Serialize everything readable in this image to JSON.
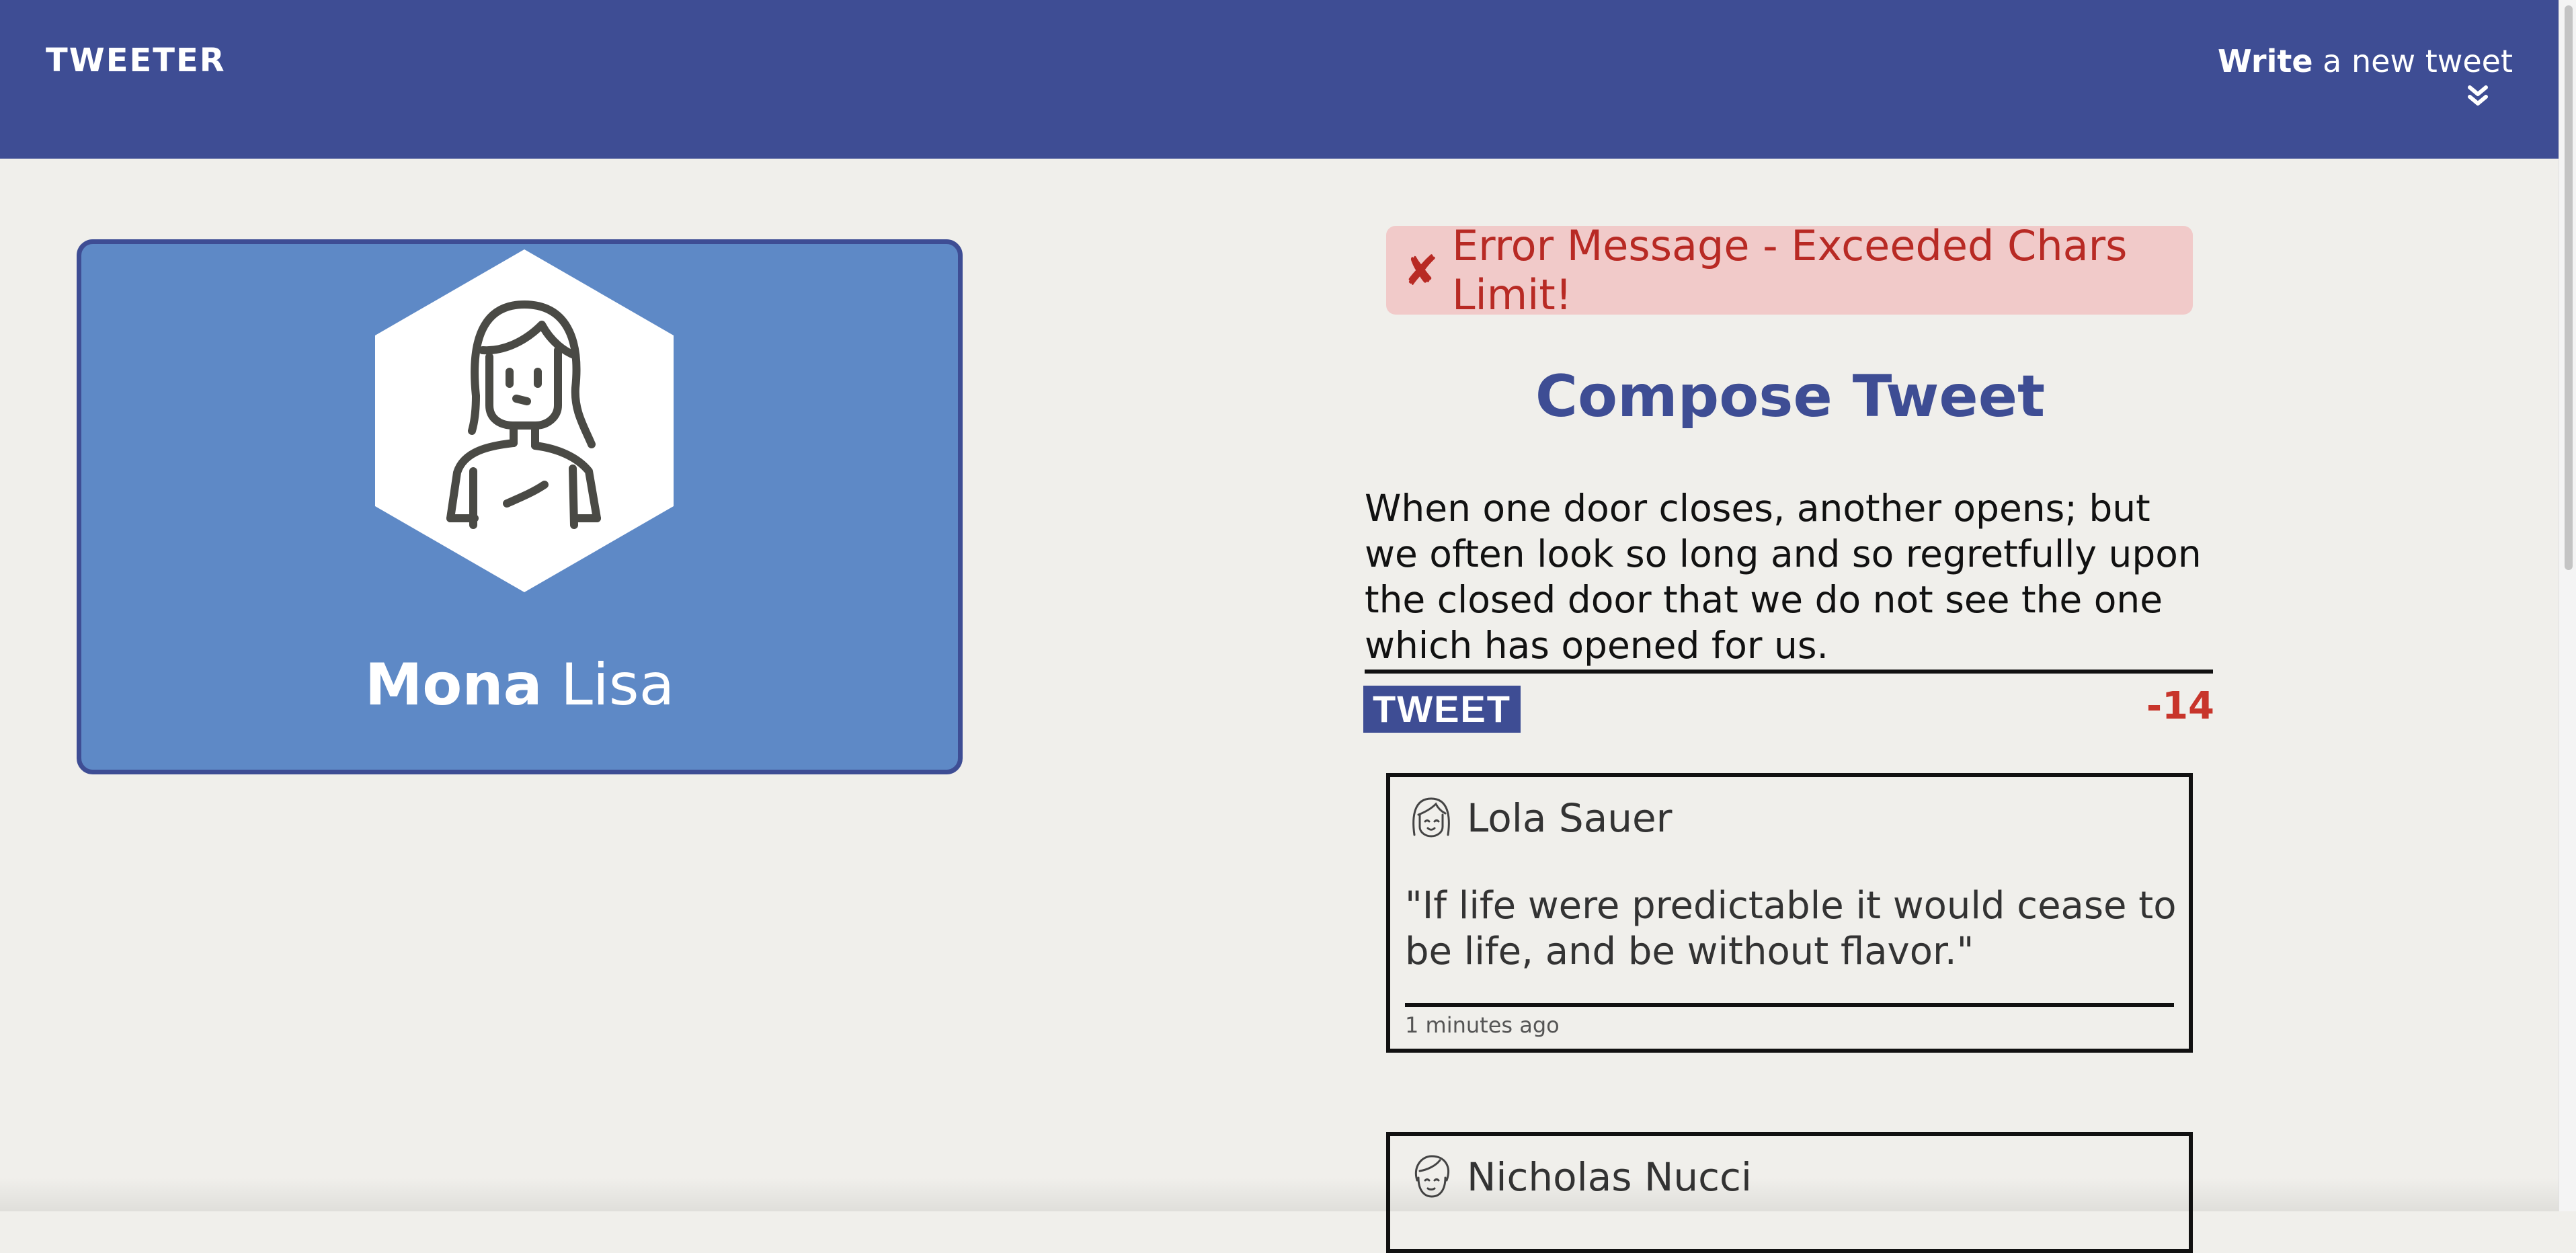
{
  "nav": {
    "brand": "TWEETER",
    "write_bold": "Write",
    "write_rest": " a new tweet",
    "chevron_icon": "double-chevron-down-icon"
  },
  "profile": {
    "first_name": "Mona",
    "last_name": "Lisa",
    "avatar_icon": "woman-avatar-icon"
  },
  "error": {
    "icon": "✘",
    "message": "Error Message - Exceeded Chars Limit!"
  },
  "compose": {
    "title": "Compose Tweet",
    "text": "When one door closes, another opens; but we often look so long and so regretfully upon the closed door that we do not see the one which has opened for us.",
    "button_label": "TWEET",
    "counter": "-14"
  },
  "tweets": [
    {
      "author": "Lola Sauer",
      "avatar_icon": "woman-face-icon",
      "content": "\"If life were predictable it would cease to be life, and be without flavor.\"",
      "time": "1 minutes ago"
    },
    {
      "author": "Nicholas Nucci",
      "avatar_icon": "man-face-icon"
    }
  ],
  "colors": {
    "nav_bg": "#3e4d94",
    "page_bg": "#f0efeb",
    "card_bg": "#5e89c6",
    "error_bg": "#f1cac9",
    "error_text": "#b82a24",
    "counter_over": "#c8352b"
  }
}
